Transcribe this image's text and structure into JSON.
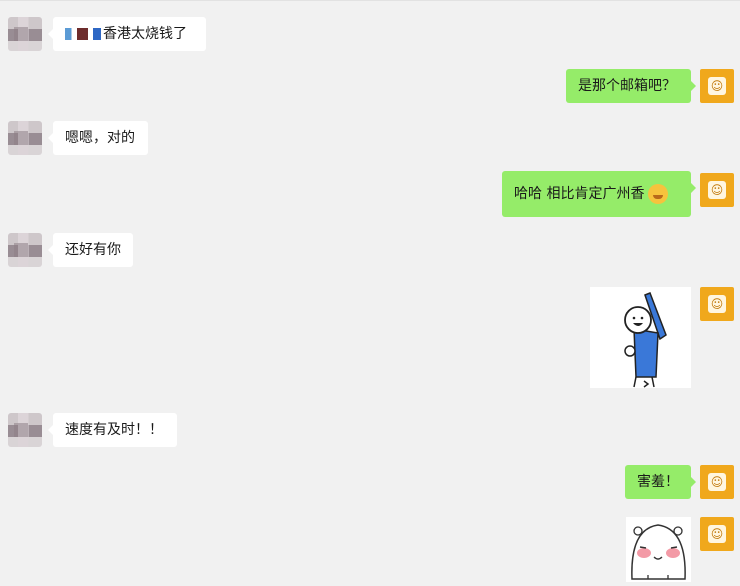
{
  "messages": [
    {
      "side": "left",
      "text": "香港太烧钱了",
      "has_blurred_prefix": true
    },
    {
      "side": "right",
      "text": "是那个邮箱吧？"
    },
    {
      "side": "left",
      "text": "嗯嗯，对的"
    },
    {
      "side": "right",
      "text": "哈哈 相比肯定广州香",
      "emoji": "grin-emoji"
    },
    {
      "side": "left",
      "text": "还好有你"
    },
    {
      "side": "right",
      "sticker": "stickman-raising-arm"
    },
    {
      "side": "left",
      "text": "速度有及时！！"
    },
    {
      "side": "right",
      "text": "害羞！"
    },
    {
      "side": "right",
      "sticker": "blushing-bun-face"
    }
  ],
  "colors": {
    "background": "#f1f1f1",
    "bubble_self": "#95ec69",
    "bubble_other": "#ffffff",
    "avatar_self": "#f0a81c"
  }
}
